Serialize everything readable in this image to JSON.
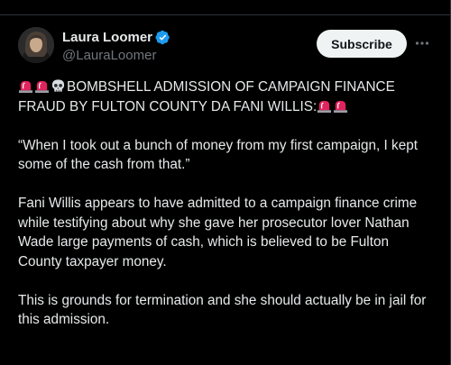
{
  "tweet": {
    "author": {
      "display_name": "Laura Loomer",
      "handle": "@LauraLoomer",
      "verified": true
    },
    "subscribe_label": "Subscribe",
    "headline": "BOMBSHELL ADMISSION OF CAMPAIGN FINANCE FRAUD BY FULTON COUNTY DA FANI WILLIS:",
    "quote": "“When I took out a bunch of money from my first campaign, I kept some of the cash from that.”",
    "paragraph_2": "Fani Willis appears to have admitted to a campaign finance crime while testifying about why she gave her prosecutor lover Nathan Wade large payments of cash, which is believed to be Fulton County taxpayer money.",
    "paragraph_3": "This is grounds for termination and she should actually be in jail for this admission.",
    "emoji": {
      "siren": "police-car-light",
      "skull": "skull"
    }
  },
  "colors": {
    "background": "#000000",
    "text": "#e7e9ea",
    "secondary_text": "#71767b",
    "verified": "#1d9bf0",
    "button_bg": "#eff3f4",
    "siren_red": "#e0245e"
  }
}
